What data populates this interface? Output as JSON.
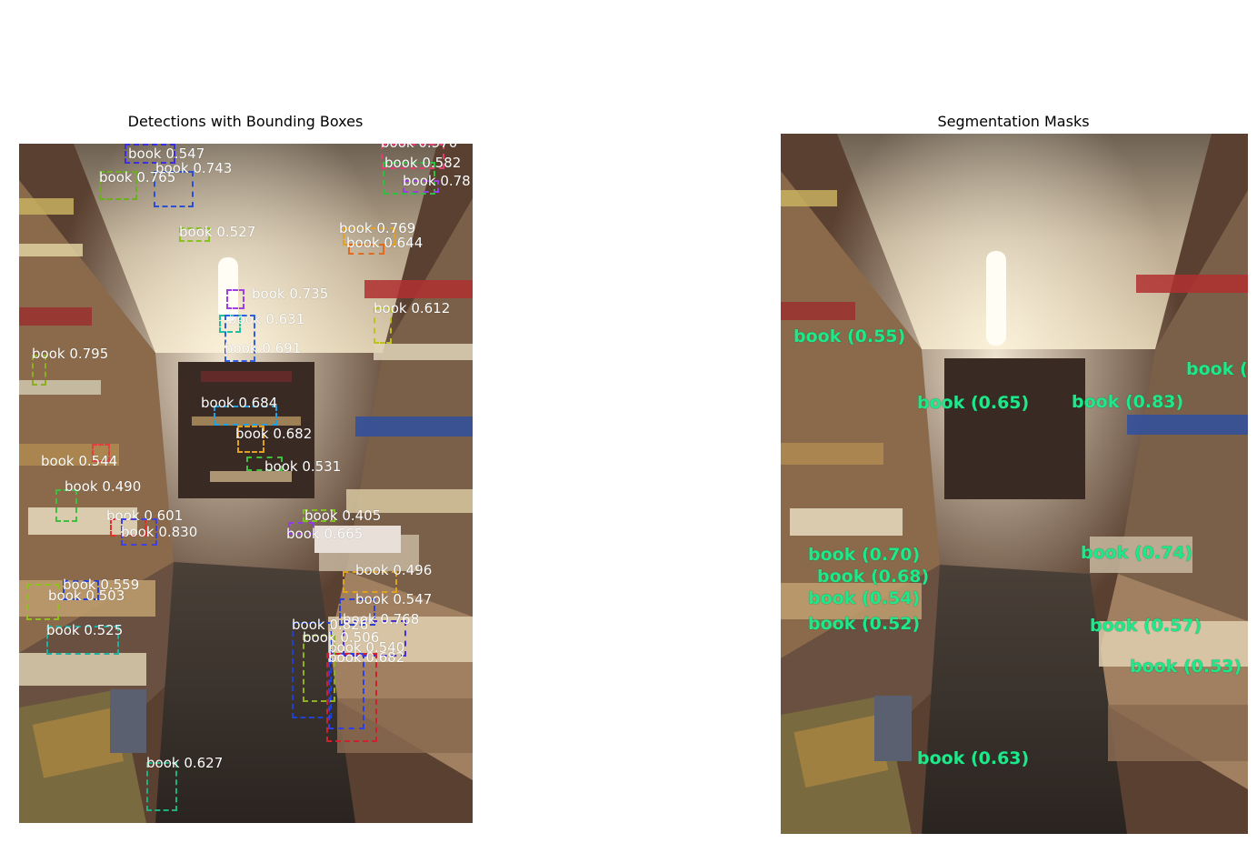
{
  "left_panel": {
    "title": "Detections with Bounding Boxes",
    "detections": [
      {
        "label": "book 0.547",
        "color": "#3a2fd8"
      },
      {
        "label": "book 0.743",
        "color": "#2a4fd0"
      },
      {
        "label": "book 0.765",
        "color": "#6ab01e"
      },
      {
        "label": "book 0.570",
        "color": "#e04070"
      },
      {
        "label": "book 0.582",
        "color": "#30c040"
      },
      {
        "label": "book 0.78",
        "color": "#9a40e0"
      },
      {
        "label": "book 0.527",
        "color": "#8ac020"
      },
      {
        "label": "book 0.769",
        "color": "#e0a020"
      },
      {
        "label": "book 0.644",
        "color": "#e06a20"
      },
      {
        "label": "book 0.735",
        "color": "#a040e0"
      },
      {
        "label": "book 0.631",
        "color": "#20c0a0"
      },
      {
        "label": "book 0.691",
        "color": "#3060e0"
      },
      {
        "label": "book 0.795",
        "color": "#8ab020"
      },
      {
        "label": "book 0.612",
        "color": "#c0c020"
      },
      {
        "label": "book 0.684",
        "color": "#20a0e0"
      },
      {
        "label": "book 0.682",
        "color": "#e0a020"
      },
      {
        "label": "book 0.544",
        "color": "#e04040"
      },
      {
        "label": "book 0.490",
        "color": "#40c040"
      },
      {
        "label": "book 0.601",
        "color": "#e03030"
      },
      {
        "label": "book 0.830",
        "color": "#4040e0"
      },
      {
        "label": "book 0.665",
        "color": "#9040e0"
      },
      {
        "label": "book 0.405",
        "color": "#80c020"
      },
      {
        "label": "book 0.496",
        "color": "#e0a020"
      },
      {
        "label": "book 0.559",
        "color": "#2a40d0"
      },
      {
        "label": "book 0.503",
        "color": "#90c020"
      },
      {
        "label": "book 0.547",
        "color": "#3040d0"
      },
      {
        "label": "book 0.525",
        "color": "#20b0a0"
      },
      {
        "label": "book 0.768",
        "color": "#4a30d0"
      },
      {
        "label": "book 0.826",
        "color": "#2040d0"
      },
      {
        "label": "book 0.506",
        "color": "#90b020"
      },
      {
        "label": "book 0.540",
        "color": "#3040e0"
      },
      {
        "label": "book 0.682",
        "color": "#d02030"
      },
      {
        "label": "book 0.627",
        "color": "#20b080"
      },
      {
        "label": "book 0.531",
        "color": "#40c040"
      }
    ]
  },
  "right_panel": {
    "title": "Segmentation Masks",
    "masks": [
      {
        "label": "book (0.55)"
      },
      {
        "label": "book (0."
      },
      {
        "label": "book (0.70)"
      },
      {
        "label": "book (0.65)"
      },
      {
        "label": "book (0.83)"
      },
      {
        "label": "book (0.74)"
      },
      {
        "label": "book (0.54)"
      },
      {
        "label": "book (0.52)"
      },
      {
        "label": "book (0.57)"
      },
      {
        "label": "book (0.53)"
      },
      {
        "label": "book (0.63)"
      },
      {
        "label": "book (0.68)"
      }
    ]
  }
}
